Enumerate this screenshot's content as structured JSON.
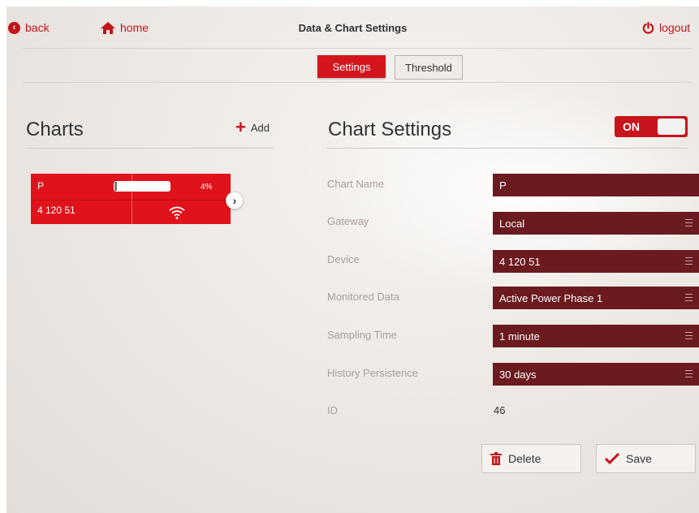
{
  "topbar": {
    "back_label": "back",
    "home_label": "home",
    "title": "Data & Chart Settings",
    "logout_label": "logout"
  },
  "tabs": [
    {
      "label": "Settings",
      "active": true
    },
    {
      "label": "Threshold",
      "active": false
    }
  ],
  "charts_panel": {
    "title": "Charts",
    "add_label": "Add",
    "card": {
      "name": "P",
      "battery_percent": 4,
      "battery_label": "4%",
      "device": "4 120 51",
      "signal_icon": "wifi-icon"
    }
  },
  "settings_panel": {
    "title": "Chart Settings",
    "toggle_label": "ON",
    "fields": {
      "chart_name": {
        "label": "Chart Name",
        "value": "P"
      },
      "gateway": {
        "label": "Gateway",
        "value": "Local"
      },
      "device": {
        "label": "Device",
        "value": "4 120 51"
      },
      "monitored_data": {
        "label": "Monitored Data",
        "value": "Active Power Phase 1"
      },
      "sampling_time": {
        "label": "Sampling Time",
        "value": "1 minute"
      },
      "history_persistence": {
        "label": "History Persistence",
        "value": "30 days"
      },
      "id": {
        "label": "ID",
        "value": "46"
      }
    },
    "delete_label": "Delete",
    "save_label": "Save"
  },
  "colors": {
    "accent": "#d3161e",
    "field_bg": "#6b1a20"
  }
}
